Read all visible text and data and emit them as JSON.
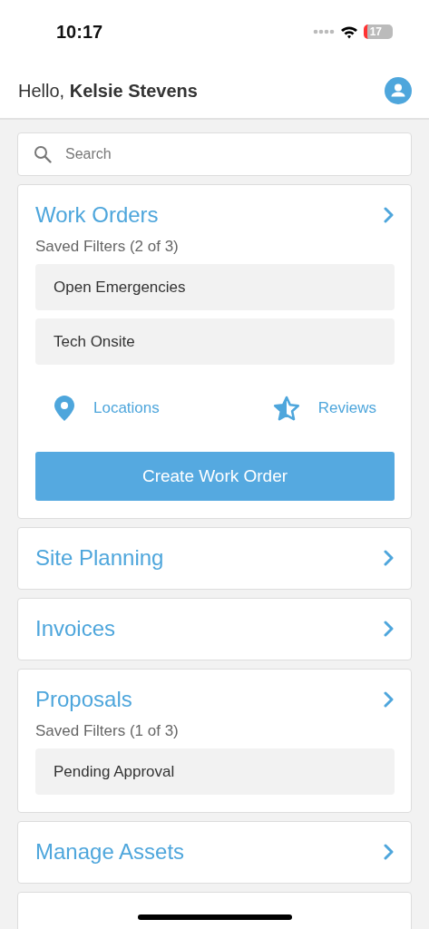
{
  "status_bar": {
    "time": "10:17",
    "battery": "17"
  },
  "header": {
    "greeting": "Hello, **Kelsie Stevens**"
  },
  "search": {
    "placeholder": "Search"
  },
  "sections": [
    {
      "title": "Work Orders",
      "saved_filters": "Saved Filters (2 of 3)",
      "filters": [
        "Open Emergencies",
        "Tech Onsite"
      ],
      "links": [
        {
          "kind": "pin",
          "label": "Locations"
        },
        {
          "kind": "star",
          "label": "Reviews"
        }
      ],
      "button": "Create Work Order"
    },
    {
      "title": "Site Planning"
    },
    {
      "title": "Invoices"
    },
    {
      "title": "Proposals",
      "saved_filters": "Saved Filters (1 of 3)",
      "filters": [
        "Pending Approval"
      ]
    },
    {
      "title": "Manage Assets"
    },
    {
      "kind": "partial"
    }
  ]
}
